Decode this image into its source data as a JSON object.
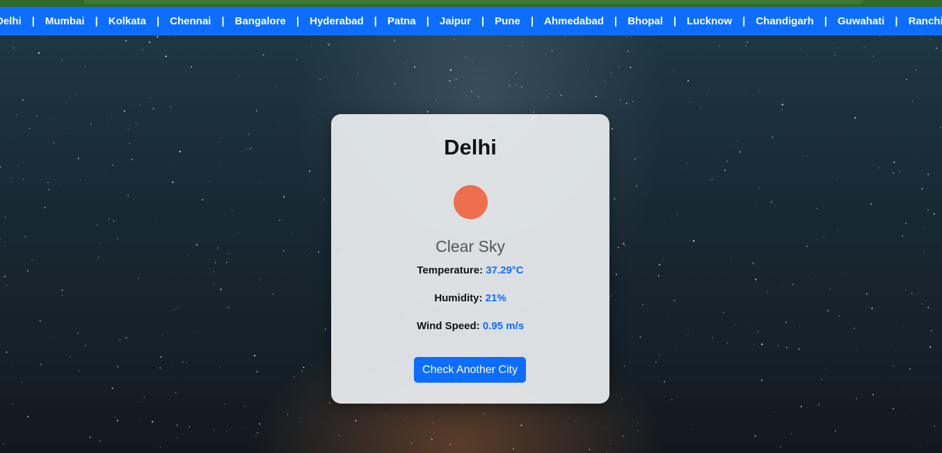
{
  "nav": {
    "cities": [
      "Delhi",
      "Mumbai",
      "Kolkata",
      "Chennai",
      "Bangalore",
      "Hyderabad",
      "Patna",
      "Jaipur",
      "Pune",
      "Ahmedabad",
      "Bhopal",
      "Lucknow",
      "Chandigarh",
      "Guwahati",
      "Ranchi"
    ],
    "separator": "|"
  },
  "weather": {
    "city": "Delhi",
    "icon": "sun-icon",
    "description": "Clear Sky",
    "temperature_label": "Temperature:",
    "temperature_value": "37.29°C",
    "humidity_label": "Humidity:",
    "humidity_value": "21%",
    "wind_label": "Wind Speed:",
    "wind_value": "0.95 m/s",
    "button_label": "Check Another City"
  },
  "colors": {
    "accent": "#0d6efd",
    "sun": "#ed6f4e",
    "top_strip": "#2f6a2a"
  }
}
